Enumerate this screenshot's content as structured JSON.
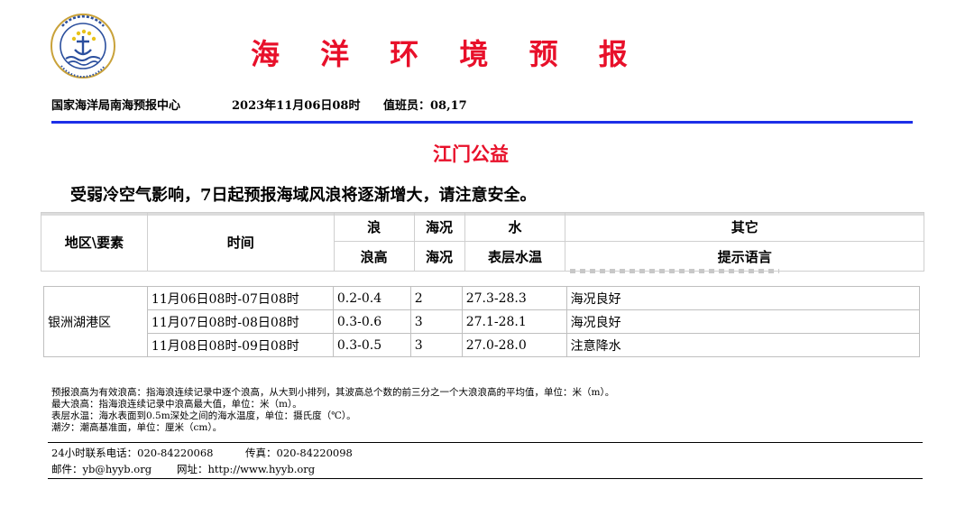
{
  "logo": {
    "icon": "sea-anchor-emblem-icon",
    "arc_text": "国家海洋局",
    "bottom_text": "STATE OCEANIC ADMINISTRATION"
  },
  "header": {
    "title": "海 洋 环 境 预 报",
    "agency": "国家海洋局南海预报中心",
    "issue_time": "2023年11月06日08时",
    "duty_staff": "值班员：08,17"
  },
  "subtitle": "江门公益",
  "headline": "受弱冷空气影响，7日起预报海域风浪将逐渐增大，请注意安全。",
  "table": {
    "headers": {
      "region": "地区\\要素",
      "time": "时间",
      "wave_group": "浪",
      "wave_height": "浪高",
      "sea_state_group": "海况",
      "sea_state": "海况",
      "water_group": "水",
      "sst": "表层水温",
      "other_group": "其它",
      "tips": "提示语言"
    },
    "region_name": "银洲湖港区",
    "rows": [
      {
        "time": "11月06日08时-07日08时",
        "wave": "0.2-0.4",
        "sea": "2",
        "sst": "27.3-28.3",
        "tip": "海况良好"
      },
      {
        "time": "11月07日08时-08日08时",
        "wave": "0.3-0.6",
        "sea": "3",
        "sst": "27.1-28.1",
        "tip": "海况良好"
      },
      {
        "time": "11月08日08时-09日08时",
        "wave": "0.3-0.5",
        "sea": "3",
        "sst": "27.0-28.0",
        "tip": "注意降水"
      }
    ]
  },
  "notes": [
    "预报浪高为有效浪高：指海浪连续记录中逐个浪高，从大到小排列，其波高总个数的前三分之一个大浪浪高的平均值，单位：米（m）。",
    "最大浪高：指海浪连续记录中浪高最大值，单位：米（m）。",
    "表层水温：海水表面到0.5m深处之间的海水温度，单位：摄氏度（℃）。",
    "潮汐：潮高基准面，单位：厘米（cm）。"
  ],
  "contact": {
    "phone": "24小时联系电话：020-84220068",
    "fax": "传真：020-84220098",
    "email": "邮件：yb@hyyb.org",
    "website": "网址：http://www.hyyb.org"
  },
  "colors": {
    "title_red": "#e8102a",
    "rule_blue": "#1d2fe8",
    "logo_blue": "#2b4f9e",
    "logo_gold": "#c9a23a"
  }
}
